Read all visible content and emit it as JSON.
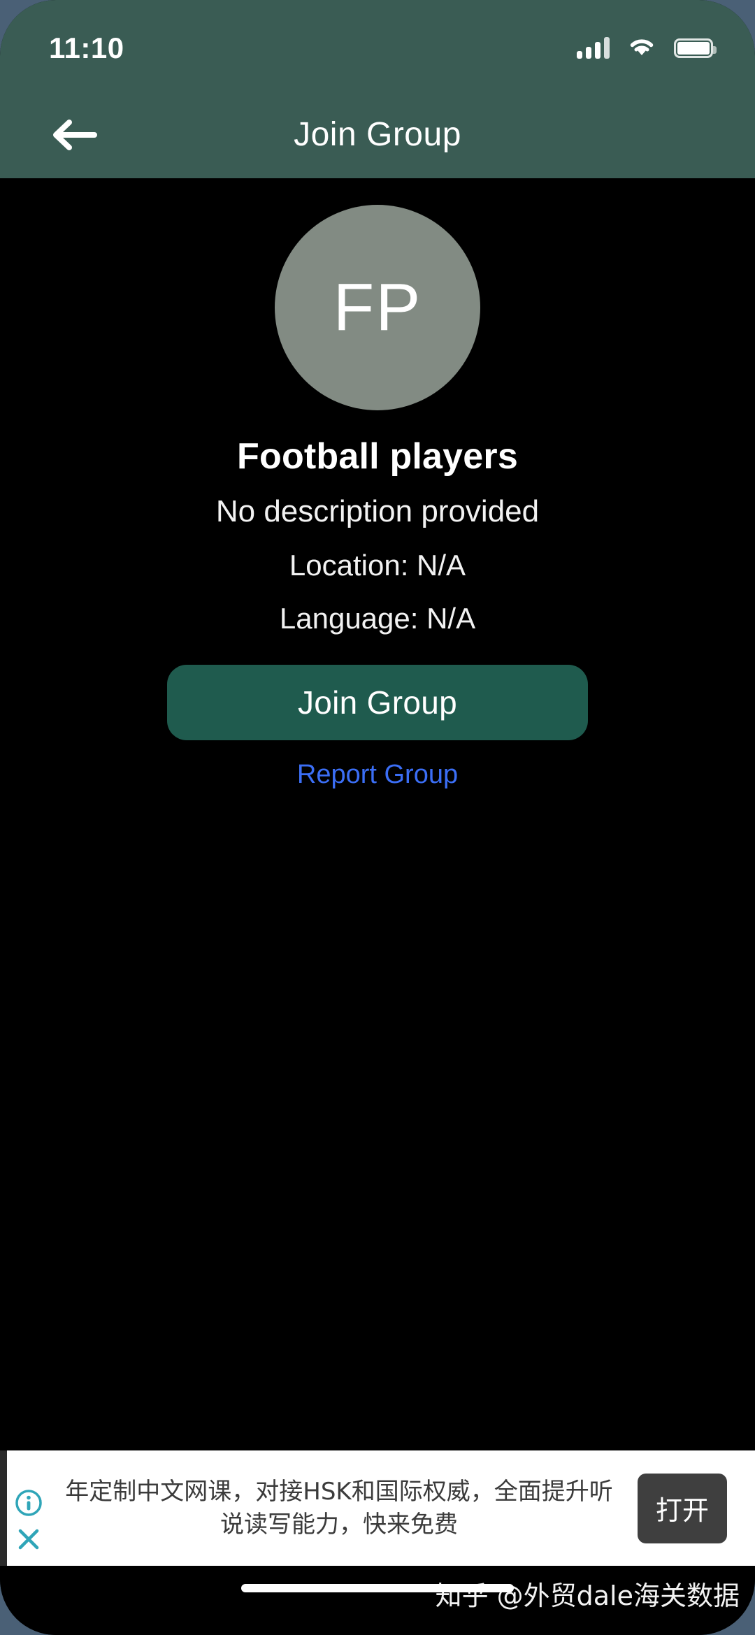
{
  "status_bar": {
    "time": "11:10",
    "signal_icon": "cellular-signal-icon",
    "wifi_icon": "wifi-icon",
    "battery_icon": "battery-full-icon"
  },
  "nav_bar": {
    "title": "Join Group",
    "back_icon": "arrow-left-icon"
  },
  "group": {
    "avatar_initials": "FP",
    "name": "Football players",
    "description": "No description provided",
    "location_line": "Location: N/A",
    "language_line": "Language: N/A",
    "join_button_label": "Join Group",
    "report_link_label": "Report Group"
  },
  "ad": {
    "body_text": "年定制中文网课，对接HSK和国际权威，全面提升听说读写能力，快来免费",
    "cta_label": "打开",
    "info_icon": "info-circle-icon",
    "close_icon": "close-x-icon"
  },
  "footer": {
    "watermark": "知乎 @外贸dale海关数据"
  },
  "colors": {
    "header_teal": "#3a5c54",
    "button_teal": "#1f5b4e",
    "avatar_gray": "#828b83",
    "link_blue": "#3b6ef5",
    "page_black": "#000000",
    "ad_white": "#ffffff",
    "ad_cta_dark": "#3f3f3f",
    "ad_accent_teal": "#2fa5b8"
  }
}
